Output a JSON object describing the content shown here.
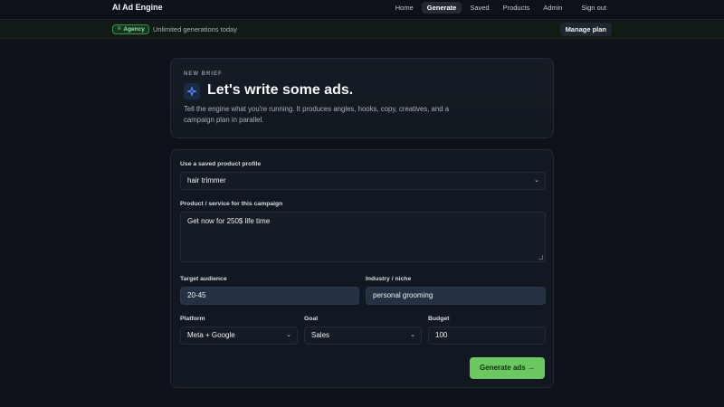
{
  "nav": {
    "brand": "AI Ad Engine",
    "links": [
      "Home",
      "Generate",
      "Saved",
      "Products",
      "Admin",
      "Sign out"
    ],
    "active": "Generate"
  },
  "banner": {
    "badge_icon": "crown-icon",
    "badge_label": "Agency",
    "text": "Unlimited generations today",
    "manage_label": "Manage plan"
  },
  "hero": {
    "eyebrow": "NEW BRIEF",
    "icon": "sparkle-icon",
    "title": "Let's write some ads.",
    "description": "Tell the engine what you're running. It produces angles, hooks, copy, creatives, and a campaign plan in parallel."
  },
  "form": {
    "profile_label": "Use a saved product profile",
    "profile_value": "hair trimmer",
    "product_label": "Product / service for this campaign",
    "product_value": "Get now for 250$ life time",
    "audience_label": "Target audience",
    "audience_value": "20-45",
    "industry_label": "Industry / niche",
    "industry_value": "personal grooming",
    "platform_label": "Platform",
    "platform_value": "Meta + Google",
    "goal_label": "Goal",
    "goal_value": "Sales",
    "budget_label": "Budget",
    "budget_value": "100",
    "submit_label": "Generate ads →"
  },
  "colors": {
    "background": "#0e1117",
    "accent_green": "#6bc860",
    "badge_green": "#8fe39b",
    "accent_blue": "#5b93ff"
  }
}
